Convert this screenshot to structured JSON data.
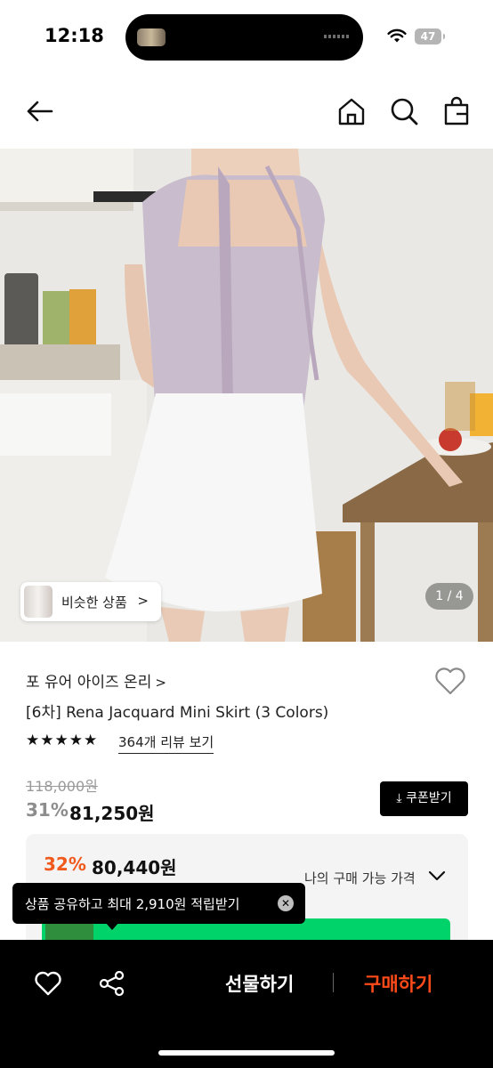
{
  "status_bar": {
    "time": "12:18",
    "battery": "47"
  },
  "nav": {
    "back_icon": "back-arrow-icon",
    "home_icon": "home-icon",
    "search_icon": "search-icon",
    "bag_icon": "shopping-bag-icon"
  },
  "hero": {
    "similar_label": "비슷한 상품",
    "similar_chevron": ">",
    "counter": "1 / 4"
  },
  "product": {
    "brand": "포 유어 아이즈 온리",
    "brand_chevron": ">",
    "name": "[6차] Rena Jacquard Mini Skirt (3 Colors)",
    "stars": "★★★★★",
    "rating_stars": 5,
    "review_link": "364개 리뷰 보기",
    "original_price": "118,000원",
    "discount": "31%",
    "price": "81,250원",
    "coupon_label": "쿠폰받기"
  },
  "best_price": {
    "discount": "32%",
    "price": "80,440원",
    "my_price_label": "나의 구매 가능 가격"
  },
  "tooltip": {
    "text": "상품 공유하고 최대 2,910원 적립받기",
    "close": "✕"
  },
  "bottom_bar": {
    "gift_label": "선물하기",
    "buy_label": "구매하기"
  },
  "colors": {
    "accent": "#f05a1e",
    "buy": "#ff4b19",
    "green": "#00d36a",
    "bar_bg": "#000000"
  }
}
